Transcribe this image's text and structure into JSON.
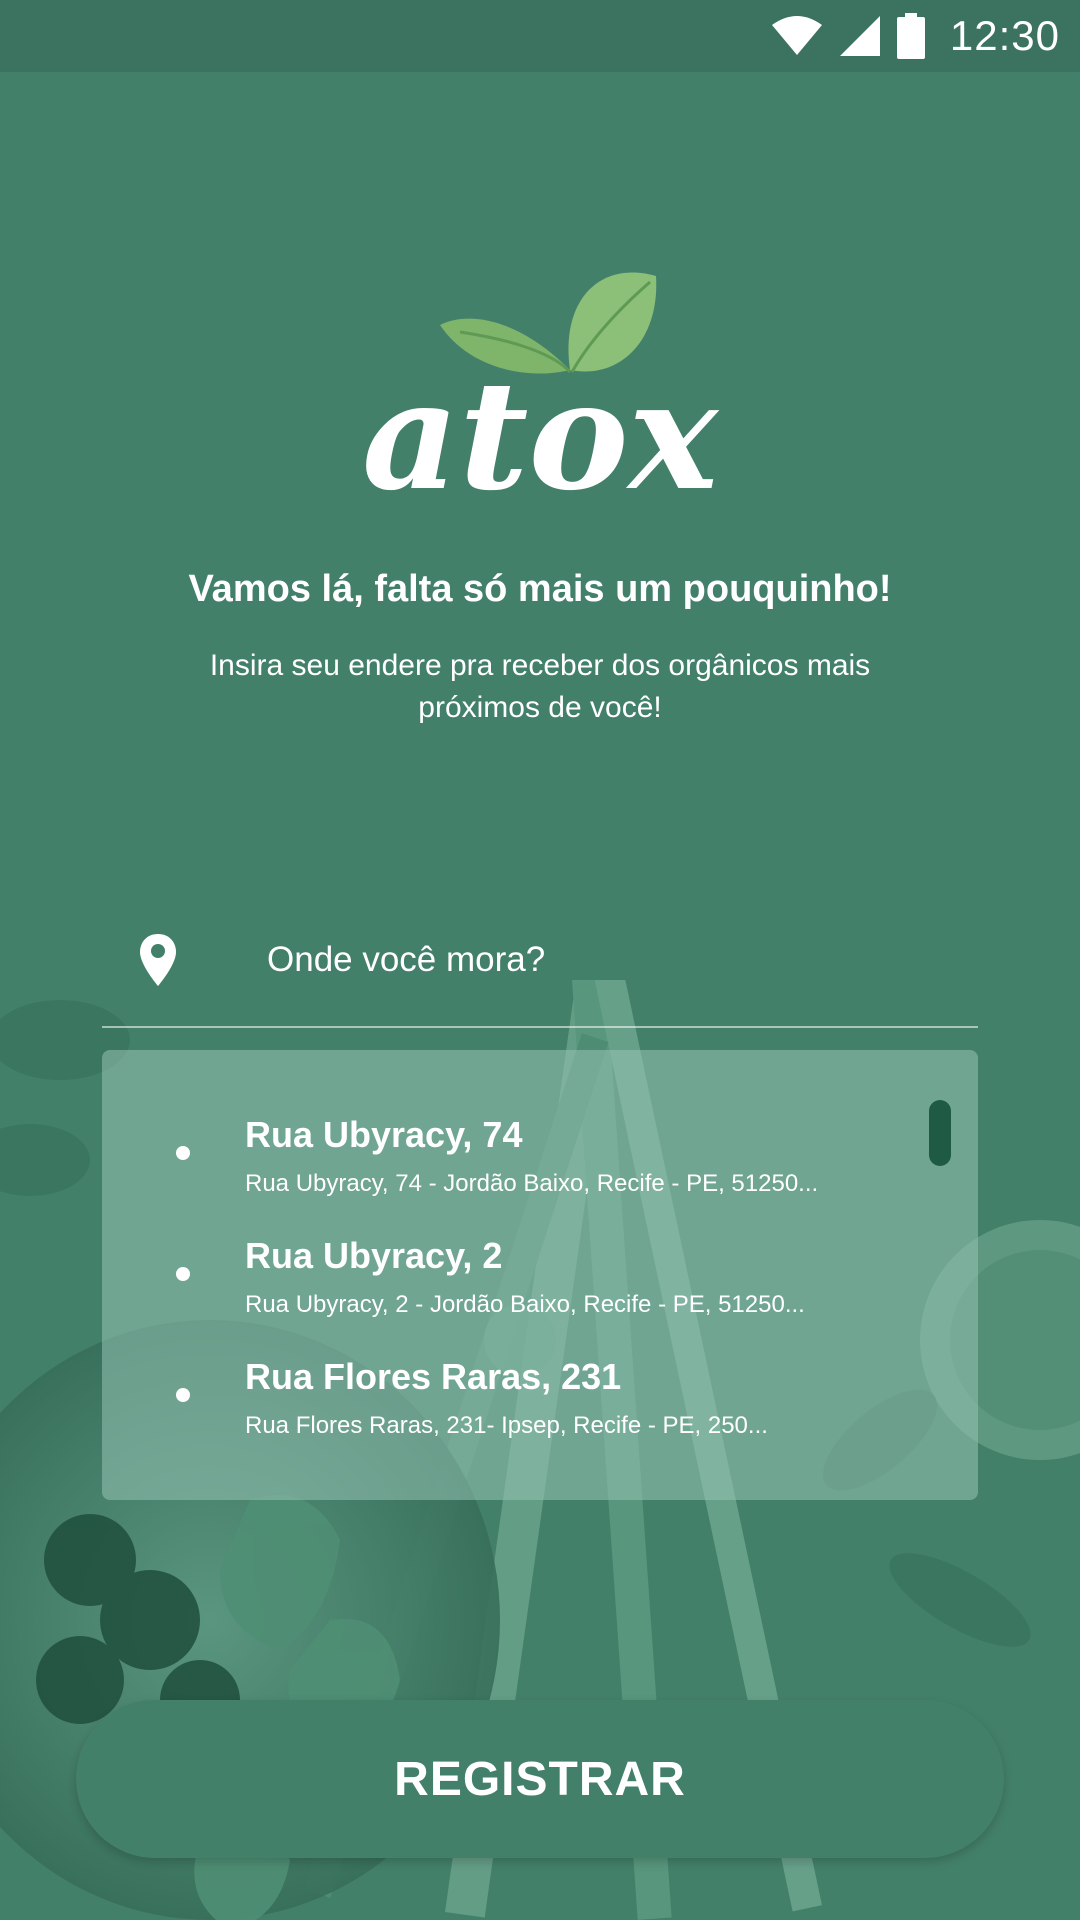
{
  "status_bar": {
    "time": "12:30",
    "icons": [
      "wifi-icon",
      "cell-signal-icon",
      "battery-icon"
    ]
  },
  "logo": {
    "text": "atox"
  },
  "intro": {
    "headline": "Vamos lá, falta só mais um pouquinho!",
    "subline": "Insira seu endere pra receber dos orgânicos mais próximos de você!"
  },
  "address_field": {
    "icon": "location-pin-icon",
    "placeholder": "Onde você mora?",
    "value": ""
  },
  "suggestions": [
    {
      "title": "Rua Ubyracy, 74",
      "detail": "Rua Ubyracy, 74 - Jordão Baixo, Recife - PE, 51250..."
    },
    {
      "title": "Rua Ubyracy, 2",
      "detail": "Rua Ubyracy, 2 - Jordão Baixo, Recife - PE, 51250..."
    },
    {
      "title": "Rua Flores Raras, 231",
      "detail": "Rua Flores Raras, 231- Ipsep, Recife - PE, 250..."
    }
  ],
  "register_button": {
    "label": "REGISTRAR"
  },
  "colors": {
    "background": "#43806a",
    "status_bar": "#3b7260",
    "leaf_green": "#8cbf78",
    "scroll_thumb": "#1f5a45"
  }
}
